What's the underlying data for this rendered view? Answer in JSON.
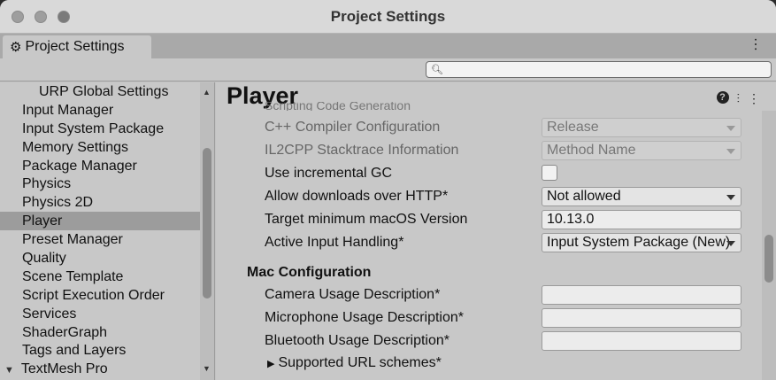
{
  "window": {
    "title": "Project Settings"
  },
  "tab": {
    "label": "Project Settings",
    "icon": "gear-icon"
  },
  "search": {
    "value": "",
    "placeholder": ""
  },
  "sidebar": {
    "items": [
      {
        "label": "URP Global Settings",
        "indent": true
      },
      {
        "label": "Input Manager"
      },
      {
        "label": "Input System Package"
      },
      {
        "label": "Memory Settings"
      },
      {
        "label": "Package Manager"
      },
      {
        "label": "Physics"
      },
      {
        "label": "Physics 2D"
      },
      {
        "label": "Player",
        "selected": true
      },
      {
        "label": "Preset Manager"
      },
      {
        "label": "Quality"
      },
      {
        "label": "Scene Template"
      },
      {
        "label": "Script Execution Order"
      },
      {
        "label": "Services"
      },
      {
        "label": "ShaderGraph"
      },
      {
        "label": "Tags and Layers"
      },
      {
        "label": "TextMesh Pro",
        "expandable": true
      }
    ]
  },
  "main": {
    "title": "Player",
    "cutoff_text": "Scripting Code Generation",
    "settings": [
      {
        "label": "C++ Compiler Configuration",
        "value": "Release",
        "type": "dropdown",
        "disabled": true
      },
      {
        "label": "IL2CPP Stacktrace Information",
        "value": "Method Name",
        "type": "dropdown",
        "disabled": true
      },
      {
        "label": "Use incremental GC",
        "value": "",
        "type": "checkbox",
        "checked": false
      },
      {
        "label": "Allow downloads over HTTP*",
        "value": "Not allowed",
        "type": "dropdown"
      },
      {
        "label": "Target minimum macOS Version",
        "value": "10.13.0",
        "type": "text"
      },
      {
        "label": "Active Input Handling*",
        "value": "Input System Package (New)",
        "type": "dropdown"
      }
    ],
    "mac_section": {
      "title": "Mac Configuration",
      "fields": [
        {
          "label": "Camera Usage Description*",
          "value": ""
        },
        {
          "label": "Microphone Usage Description*",
          "value": ""
        },
        {
          "label": "Bluetooth Usage Description*",
          "value": ""
        }
      ],
      "foldout": "Supported URL schemes*"
    }
  }
}
